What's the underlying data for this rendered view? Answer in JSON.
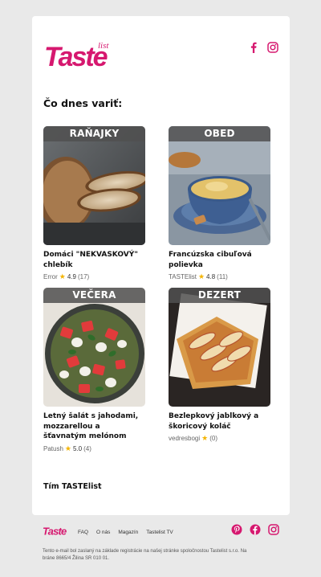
{
  "brand": {
    "logo_main": "Taste",
    "logo_small": "list",
    "accent": "#d6186f"
  },
  "social": [
    "facebook-icon",
    "instagram-icon",
    "pinterest-icon"
  ],
  "headline": "Čo dnes variť:",
  "tiles": [
    {
      "tag": "RAŇAJKY",
      "title": "Domáci \"NEKVASKOVÝ\" chlebík",
      "author": "Error",
      "rating": "4.9",
      "count": "(17)"
    },
    {
      "tag": "OBED",
      "title": "Francúzska cibuľová polievka",
      "author": "TASTElist",
      "rating": "4.8",
      "count": "(11)"
    },
    {
      "tag": "VEČERA",
      "title": "Letný šalát s jahodami, mozzarellou a šťavnatým melónom",
      "author": "Patush",
      "rating": "5.0",
      "count": "(4)"
    },
    {
      "tag": "DEZERT",
      "title": "Bezlepkový jablkový a škoricový koláč",
      "author": "vedresbogi",
      "rating": "",
      "count": "(0)"
    }
  ],
  "signature": "Tím TASTElist",
  "footer": {
    "nav": [
      "FAQ",
      "O nás",
      "Magazín",
      "Tastelist TV"
    ],
    "legal": "Tento e-mail bol zaslaný na základe registrácie na našej stránke spoločnostou Tastelist s.r.o. Na bráne 8665/4 Žilina SR 010 01."
  }
}
